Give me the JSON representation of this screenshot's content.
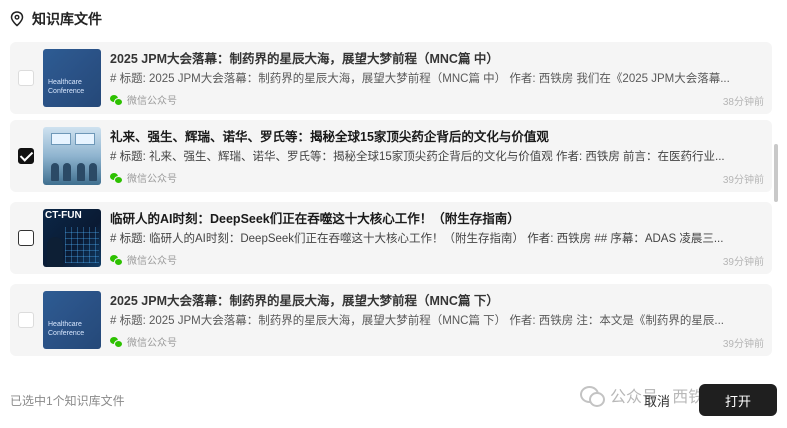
{
  "header": {
    "title": "知识库文件",
    "icon": "location-pin-icon"
  },
  "items": [
    {
      "title": "2025 JPM大会落幕：制药界的星辰大海，展望大梦前程（MNC篇 中）",
      "desc": "# 标题: 2025 JPM大会落幕：制药界的星辰大海，展望大梦前程（MNC篇 中） 作者: 西铁房 我们在《2025 JPM大会落幕...",
      "source": "微信公众号",
      "time": "38分钟前",
      "checked": false,
      "thumb_lines": [
        "Healthcare",
        "Conference"
      ]
    },
    {
      "title": "礼来、强生、辉瑞、诺华、罗氏等：揭秘全球15家顶尖药企背后的文化与价值观",
      "desc": "# 标题: 礼来、强生、辉瑞、诺华、罗氏等：揭秘全球15家顶尖药企背后的文化与价值观 作者: 西铁房 前言：在医药行业...",
      "source": "微信公众号",
      "time": "39分钟前",
      "checked": true
    },
    {
      "title": "临研人的AI时刻：DeepSeek们正在吞噬这十大核心工作！（附生存指南）",
      "desc": "# 标题: 临研人的AI时刻：DeepSeek们正在吞噬这十大核心工作！（附生存指南） 作者: 西铁房 ## 序幕：ADAS 凌晨三...",
      "source": "微信公众号",
      "time": "39分钟前",
      "checked": false,
      "thumb_text": "CT-FUN"
    },
    {
      "title": "2025 JPM大会落幕：制药界的星辰大海，展望大梦前程（MNC篇 下）",
      "desc": "# 标题: 2025 JPM大会落幕：制药界的星辰大海，展望大梦前程（MNC篇 下） 作者: 西铁房 注：本文是《制药界的星辰...",
      "source": "微信公众号",
      "time": "39分钟前",
      "checked": false,
      "thumb_lines": [
        "Healthcare",
        "Conference"
      ]
    }
  ],
  "footer": {
    "status": "已选中1个知识库文件",
    "watermark": "公众号 · 西铁房",
    "cancel_label": "取消",
    "open_label": "打开"
  },
  "colors": {
    "primary_button": "#1f1f1f",
    "card_bg": "#f5f5f5",
    "wechat_green": "#2dc100"
  }
}
